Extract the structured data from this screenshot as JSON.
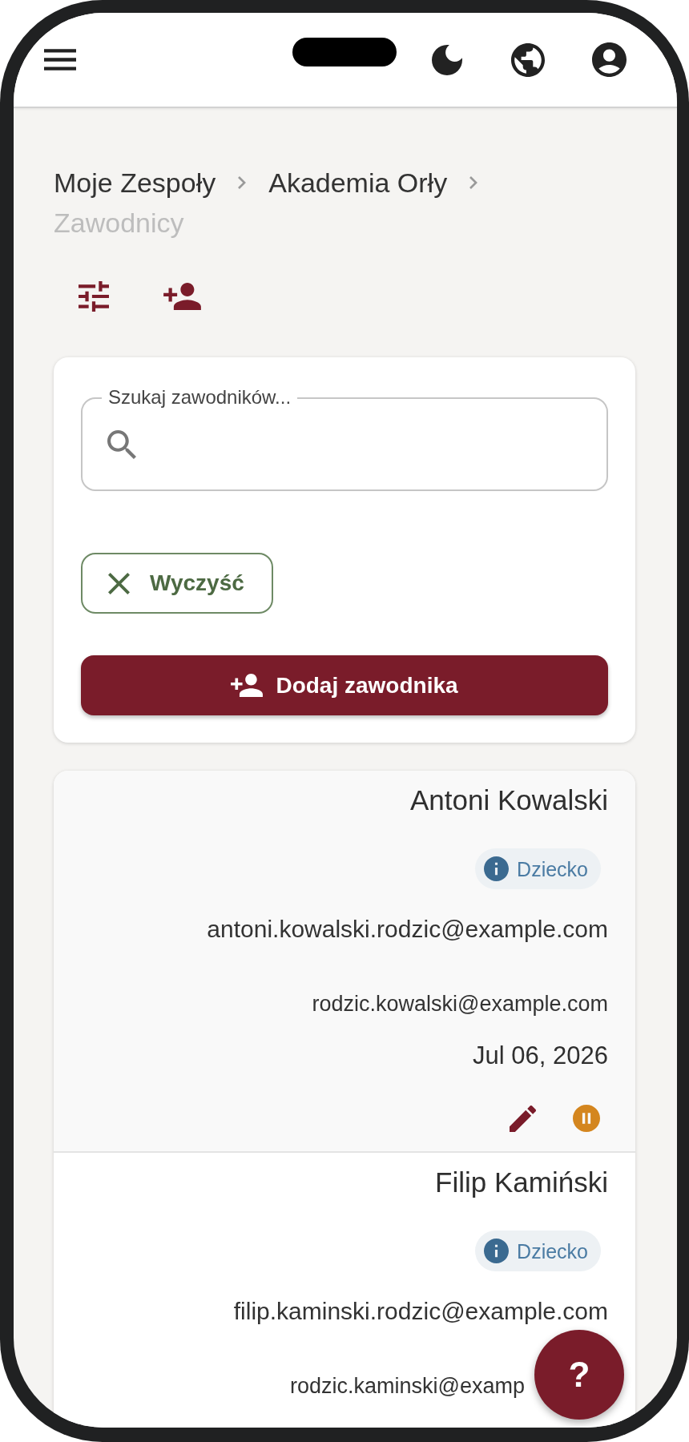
{
  "breadcrumbs": [
    {
      "label": "Moje Zespoły",
      "current": false
    },
    {
      "label": "Akademia Orły",
      "current": false
    },
    {
      "label": "Zawodnicy",
      "current": true
    }
  ],
  "search": {
    "label": "Szukaj zawodników..."
  },
  "clear_button": {
    "label": "Wyczyść"
  },
  "add_button": {
    "label": "Dodaj zawodnika"
  },
  "players": [
    {
      "name": "Antoni Kowalski",
      "tag": "Dziecko",
      "email": "antoni.kowalski.rodzic@example.com",
      "second_email": "rodzic.kowalski@example.com",
      "date": "Jul 06, 2026",
      "actions": [
        {
          "kind": "edit"
        },
        {
          "kind": "pause"
        }
      ]
    },
    {
      "name": "Filip Kamiński",
      "tag": "Dziecko",
      "email": "filip.kaminski.rodzic@example.com",
      "second_email": "rodzic.kaminski@examp"
    }
  ],
  "help_button": {
    "label": "?"
  }
}
